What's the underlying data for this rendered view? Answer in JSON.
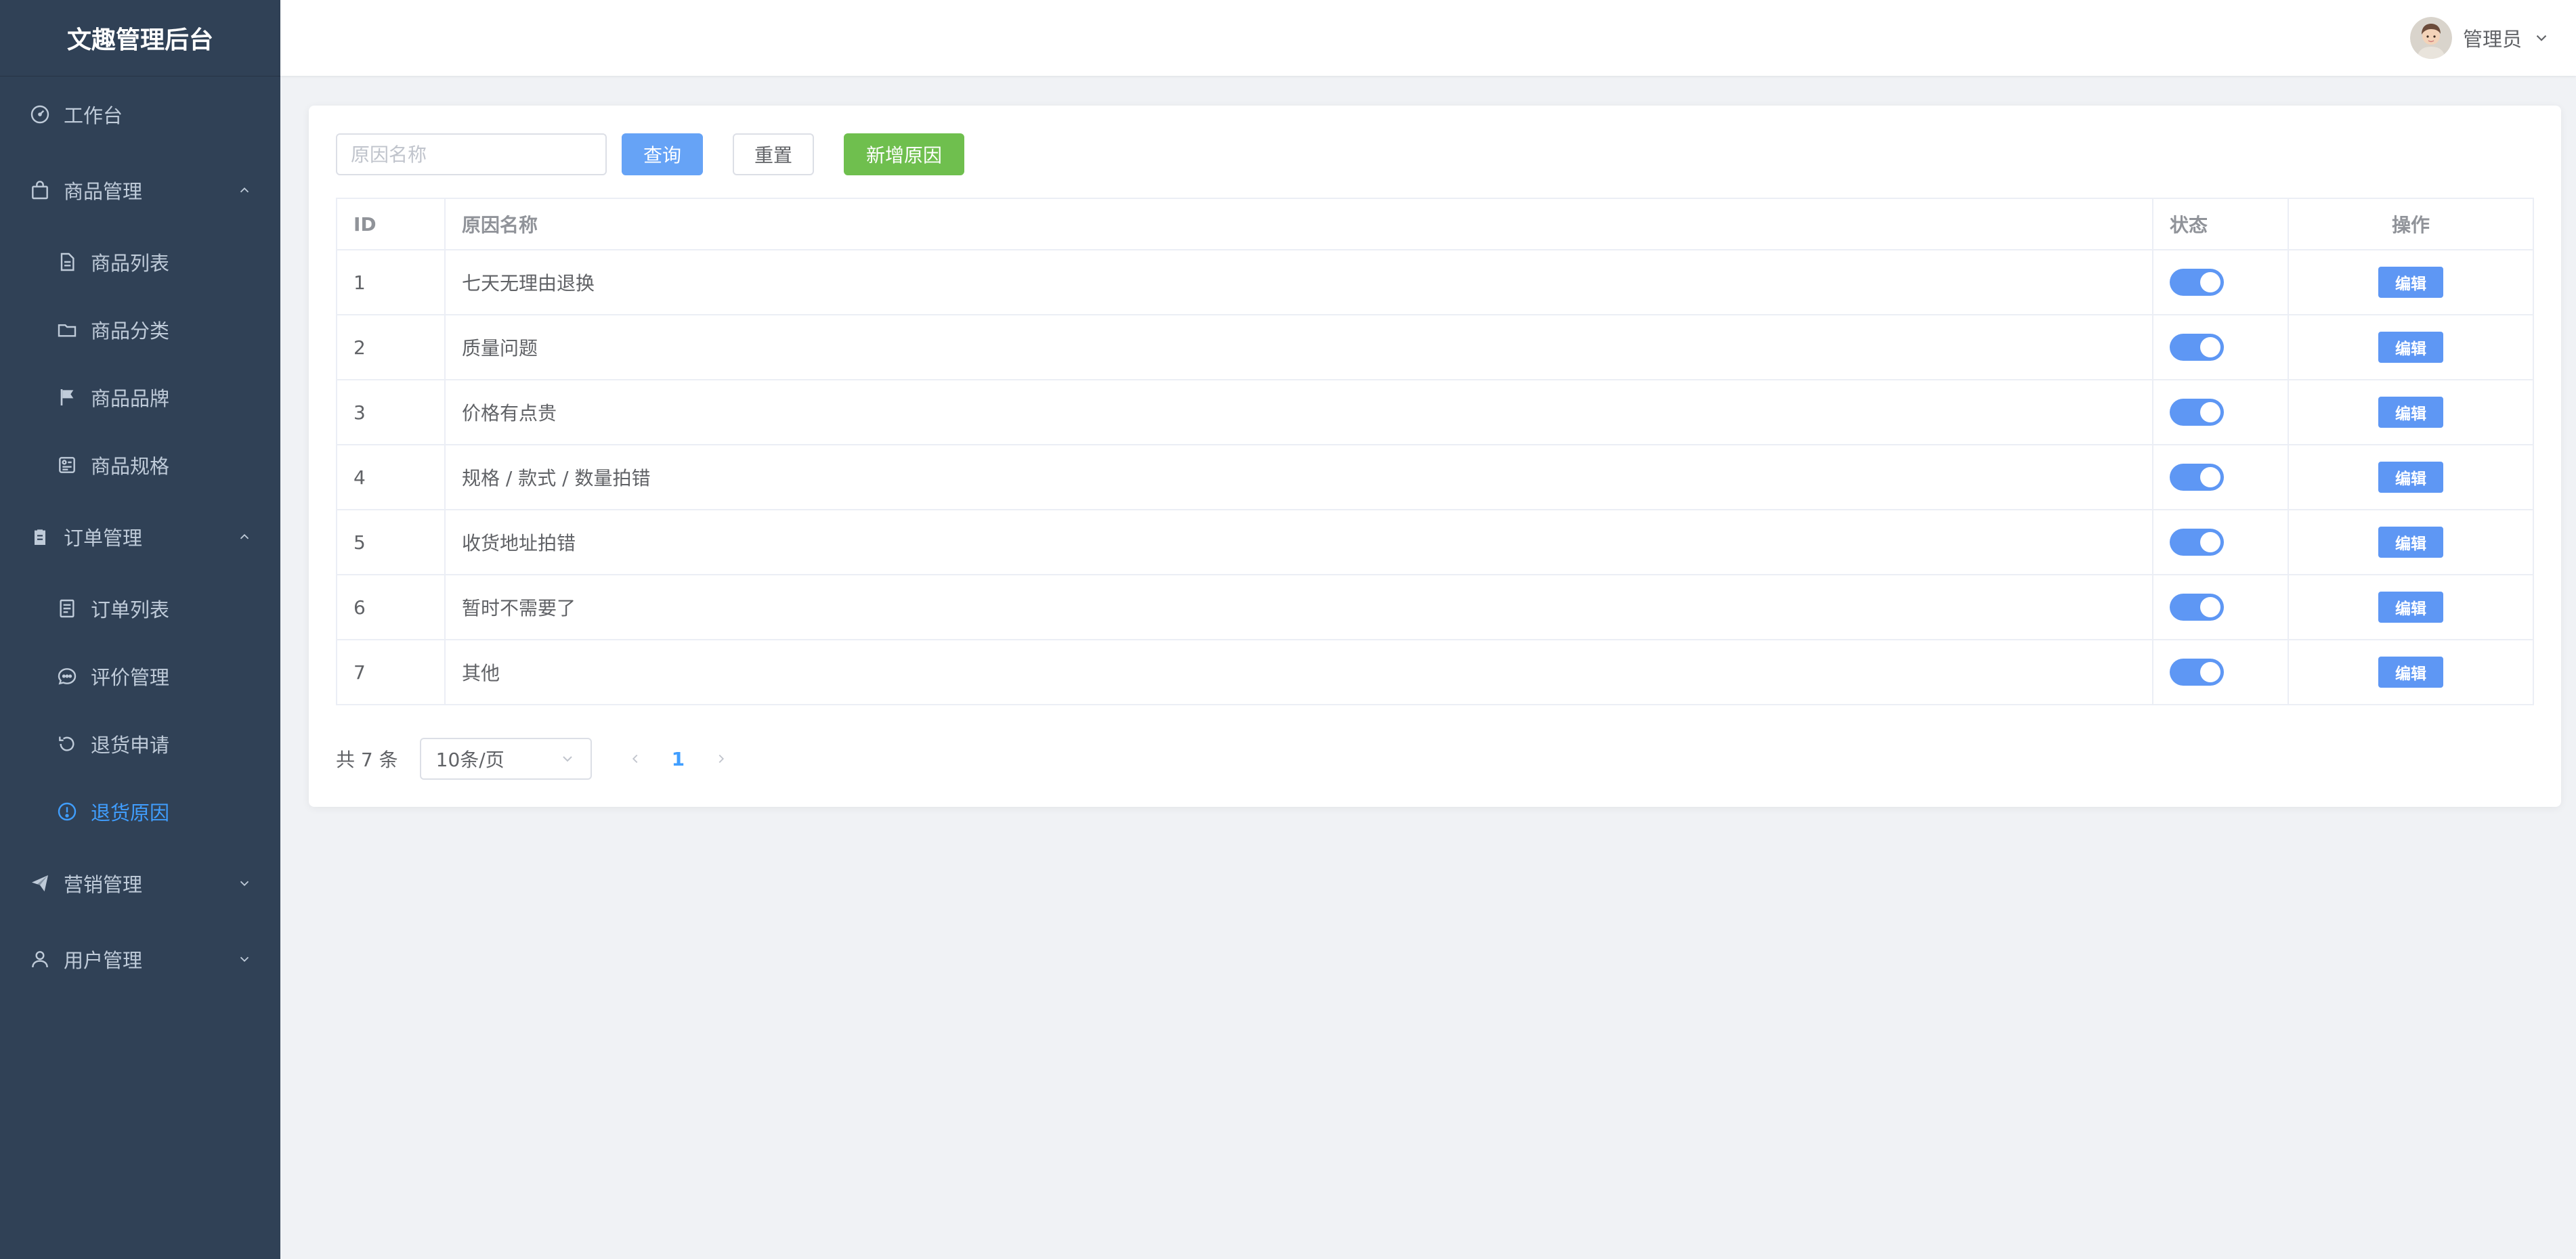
{
  "app_title": "文趣管理后台",
  "user": {
    "name": "管理员"
  },
  "sidebar": {
    "workbench": "工作台",
    "goods": {
      "label": "商品管理",
      "items": [
        "商品列表",
        "商品分类",
        "商品品牌",
        "商品规格"
      ]
    },
    "orders": {
      "label": "订单管理",
      "items": [
        "订单列表",
        "评价管理",
        "退货申请",
        "退货原因"
      ]
    },
    "marketing": "营销管理",
    "users": "用户管理",
    "active_item": "退货原因"
  },
  "toolbar": {
    "search_placeholder": "原因名称",
    "search_value": "",
    "query_label": "查询",
    "reset_label": "重置",
    "add_label": "新增原因"
  },
  "table": {
    "headers": {
      "id": "ID",
      "name": "原因名称",
      "status": "状态",
      "op": "操作"
    },
    "edit_label": "编辑",
    "rows": [
      {
        "id": "1",
        "name": "七天无理由退换",
        "enabled": true
      },
      {
        "id": "2",
        "name": "质量问题",
        "enabled": true
      },
      {
        "id": "3",
        "name": "价格有点贵",
        "enabled": true
      },
      {
        "id": "4",
        "name": "规格 / 款式 / 数量拍错",
        "enabled": true
      },
      {
        "id": "5",
        "name": "收货地址拍错",
        "enabled": true
      },
      {
        "id": "6",
        "name": "暂时不需要了",
        "enabled": true
      },
      {
        "id": "7",
        "name": "其他",
        "enabled": true
      }
    ]
  },
  "pagination": {
    "total_text": "共 7 条",
    "page_size": "10条/页",
    "current_page": "1"
  },
  "colors": {
    "sidebar_bg": "#304156",
    "accent": "#409eff",
    "primary_btn": "#66a3f6",
    "success_btn": "#6fbf4e"
  }
}
